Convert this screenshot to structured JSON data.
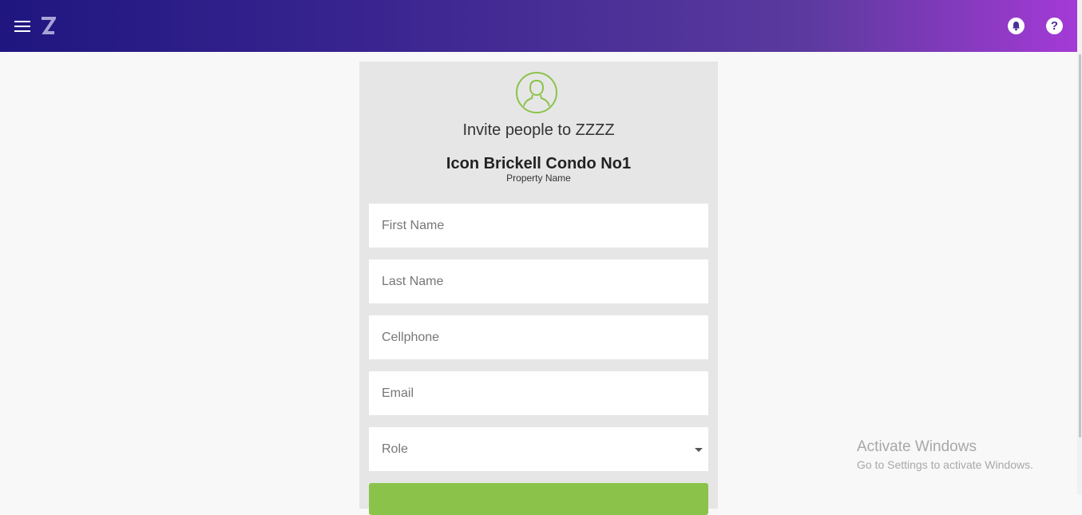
{
  "header": {
    "menu_icon": "hamburger-menu-icon",
    "logo_icon": "z-logo-icon",
    "notification_icon": "bell-icon",
    "help_icon": "help-icon",
    "help_glyph": "?",
    "gradient_start": "#1f1680",
    "gradient_end": "#a43ad6"
  },
  "invite": {
    "avatar_icon": "user-avatar-icon",
    "title": "Invite people to ZZZZ",
    "property_name": "Icon Brickell Condo No1",
    "property_caption": "Property Name",
    "accent_color": "#8bc34a"
  },
  "form": {
    "first_name": {
      "placeholder": "First Name",
      "value": ""
    },
    "last_name": {
      "placeholder": "Last Name",
      "value": ""
    },
    "cellphone": {
      "placeholder": "Cellphone",
      "value": ""
    },
    "email": {
      "placeholder": "Email",
      "value": ""
    },
    "role": {
      "label": "Role",
      "selected": ""
    },
    "submit_color": "#8bc34a"
  },
  "watermark": {
    "title": "Activate Windows",
    "subtitle": "Go to Settings to activate Windows."
  }
}
